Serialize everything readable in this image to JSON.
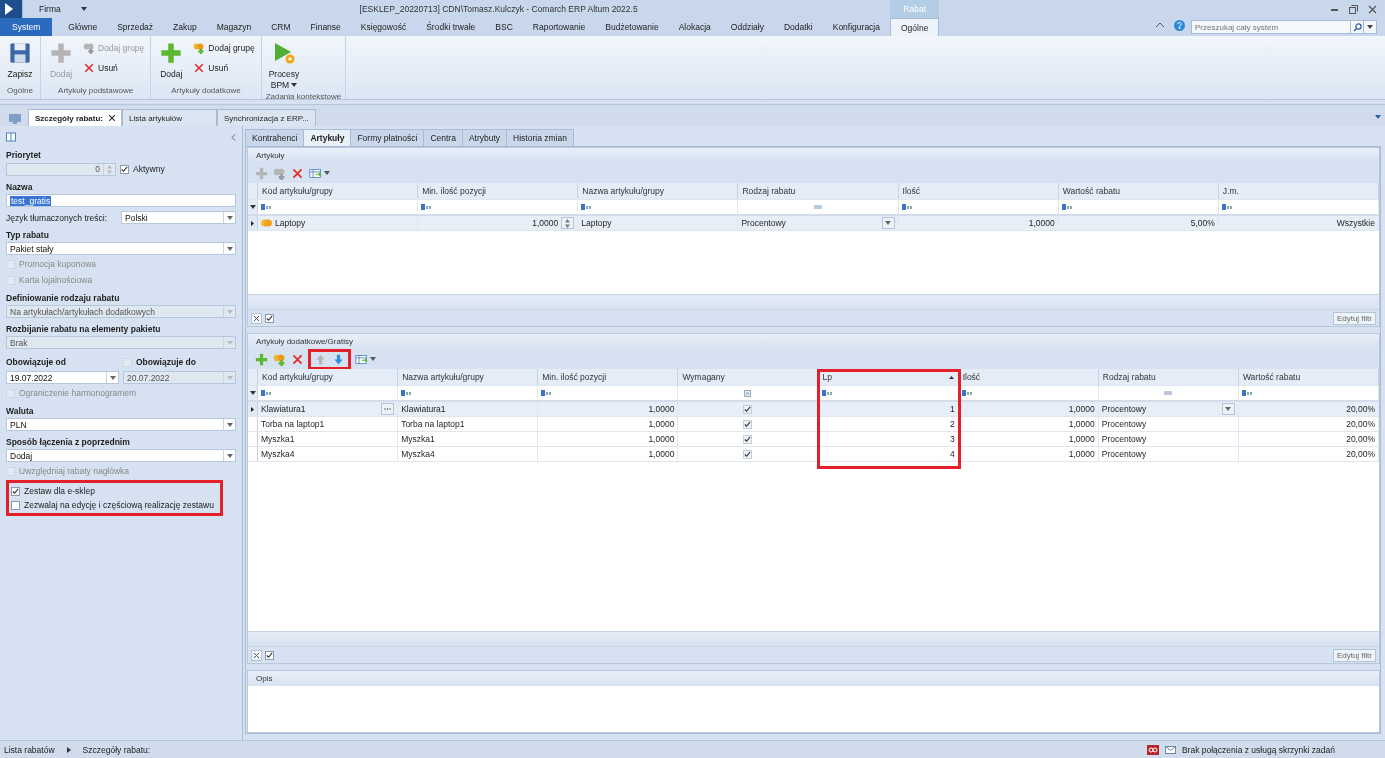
{
  "title_bar": {
    "company": "Firma",
    "title": "[ESKLEP_20220713] CDN\\Tomasz.Kulczyk - Comarch ERP Altum 2022.5"
  },
  "ribbon": {
    "context_label": "Rabat",
    "search_placeholder": "Przeszukaj cały system",
    "tabs": [
      {
        "label": "System",
        "kind": "file",
        "selected": false
      },
      {
        "label": "Główne",
        "kind": "tab",
        "selected": false
      },
      {
        "label": "Sprzedaż",
        "kind": "tab",
        "selected": false
      },
      {
        "label": "Zakup",
        "kind": "tab",
        "selected": false
      },
      {
        "label": "Magazyn",
        "kind": "tab",
        "selected": false
      },
      {
        "label": "CRM",
        "kind": "tab",
        "selected": false
      },
      {
        "label": "Finanse",
        "kind": "tab",
        "selected": false
      },
      {
        "label": "Księgowość",
        "kind": "tab",
        "selected": false
      },
      {
        "label": "Środki trwałe",
        "kind": "tab",
        "selected": false
      },
      {
        "label": "BSC",
        "kind": "tab",
        "selected": false
      },
      {
        "label": "Raportowanie",
        "kind": "tab",
        "selected": false
      },
      {
        "label": "Budżetowanie",
        "kind": "tab",
        "selected": false
      },
      {
        "label": "Alokacja",
        "kind": "tab",
        "selected": false
      },
      {
        "label": "Oddziały",
        "kind": "tab",
        "selected": false
      },
      {
        "label": "Dodatki",
        "kind": "tab",
        "selected": false
      },
      {
        "label": "Konfiguracja",
        "kind": "tab",
        "selected": false
      },
      {
        "label": "Ogólne",
        "kind": "contextual",
        "selected": true
      }
    ],
    "groups": [
      {
        "label": "Ogólne",
        "buttons": [
          {
            "kind": "save",
            "label": "Zapisz",
            "disabled": false
          }
        ]
      },
      {
        "label": "Artykuły podstawowe",
        "buttons": [
          {
            "kind": "add",
            "label": "Dodaj",
            "disabled": true
          },
          {
            "kind": "add_group",
            "label": "Dodaj grupę",
            "disabled": true
          },
          {
            "kind": "delete",
            "label": "Usuń",
            "disabled": false
          }
        ]
      },
      {
        "label": "Artykuły dodatkowe",
        "buttons": [
          {
            "kind": "add",
            "label": "Dodaj",
            "disabled": false
          },
          {
            "kind": "add_group",
            "label": "Dodaj grupę",
            "disabled": false
          },
          {
            "kind": "delete",
            "label": "Usuń",
            "disabled": false
          }
        ]
      },
      {
        "label": "Zadania kontekstowe",
        "buttons": [
          {
            "kind": "process",
            "label": "Procesy",
            "label2": "BPM",
            "dropdown": true,
            "disabled": false
          }
        ]
      }
    ]
  },
  "document_tabs": [
    {
      "label": "Szczegóły rabatu:",
      "selected": true,
      "closable": true
    },
    {
      "label": "Lista artykułów",
      "selected": false,
      "closable": false
    },
    {
      "label": "Synchronizacja z ERP...",
      "selected": false,
      "closable": false
    }
  ],
  "form": [
    {
      "kind": "spin",
      "label": "Priorytet",
      "value": "0",
      "checkbox": {
        "label": "Aktywny",
        "checked": true
      }
    },
    {
      "kind": "text",
      "label": "Nazwa",
      "value": "test_gratis",
      "value_selected": true
    },
    {
      "kind": "inline_combo",
      "label": "Język tłumaczonych treści:",
      "value": "Polski"
    },
    {
      "kind": "combo",
      "label": "Typ rabatu",
      "value": "Pakiet stały",
      "disabled": false
    },
    {
      "kind": "checkbox",
      "label": "Promocja kuponowa",
      "checked": false,
      "disabled": true
    },
    {
      "kind": "checkbox",
      "label": "Karta lojalnościowa",
      "checked": false,
      "disabled": true
    },
    {
      "kind": "combo",
      "label": "Definiowanie rodzaju rabatu",
      "value": "Na artykułach/artykułach dodatkowych",
      "disabled": true
    },
    {
      "kind": "combo",
      "label": "Rozbijanie rabatu na elementy pakietu",
      "value": "Brak",
      "disabled": true
    },
    {
      "kind": "date_pair",
      "from": {
        "label": "Obowiązuje od",
        "value": "19.07.2022",
        "disabled": false
      },
      "to": {
        "label": "Obowiązuje do",
        "value": "20.07.2022",
        "checked": false,
        "disabled": true
      }
    },
    {
      "kind": "checkbox",
      "label": "Ograniczenie harmonogramem",
      "checked": false,
      "disabled": true
    },
    {
      "kind": "combo",
      "label": "Waluta",
      "value": "PLN",
      "disabled": false
    },
    {
      "kind": "combo",
      "label": "Sposób łączenia z poprzednim",
      "value": "Dodaj",
      "disabled": false
    },
    {
      "kind": "checkbox",
      "label": "Uwzględniaj rabaty nagłówka",
      "checked": false,
      "disabled": true
    },
    {
      "kind": "checkbox_group",
      "highlighted": true,
      "items": [
        {
          "label": "Zestaw dla e-sklep",
          "checked": true,
          "disabled": false
        },
        {
          "label": "Zezwalaj na edycję i częściową realizację zestawu",
          "checked": false,
          "disabled": false
        }
      ]
    }
  ],
  "inner_tabs": [
    {
      "label": "Kontrahenci",
      "selected": false
    },
    {
      "label": "Artykuły",
      "selected": true
    },
    {
      "label": "Formy płatności",
      "selected": false
    },
    {
      "label": "Centra",
      "selected": false
    },
    {
      "label": "Atrybuty",
      "selected": false
    },
    {
      "label": "Historia zmian",
      "selected": false
    }
  ],
  "grids": [
    {
      "title": "Artykuły",
      "footer_button": "Edytuj filtr",
      "filter_enabled": true,
      "toolbar": [
        {
          "kind": "add",
          "disabled": true,
          "highlighted": false
        },
        {
          "kind": "add_group",
          "disabled": true,
          "highlighted": false
        },
        {
          "kind": "delete",
          "disabled": false,
          "highlighted": false
        },
        {
          "kind": "export",
          "disabled": false,
          "highlighted": false
        }
      ],
      "columns": [
        {
          "label": "Kod artykułu/grupy",
          "kind": "text",
          "highlighted": false,
          "sorted": false
        },
        {
          "label": "Min. ilość pozycji",
          "kind": "spin",
          "highlighted": false,
          "sorted": false
        },
        {
          "label": "Nazwa artykułu/grupy",
          "kind": "text",
          "highlighted": false,
          "sorted": false
        },
        {
          "label": "Rodzaj rabatu",
          "kind": "combo",
          "highlighted": false,
          "sorted": false
        },
        {
          "label": "Ilość",
          "kind": "number",
          "highlighted": false,
          "sorted": false
        },
        {
          "label": "Wartość rabatu",
          "kind": "number",
          "highlighted": false,
          "sorted": false
        },
        {
          "label": "J.m.",
          "kind": "number",
          "highlighted": false,
          "sorted": false
        }
      ],
      "rows": [
        {
          "kind": "group",
          "selected": true,
          "cells": [
            "Laptopy",
            "1,0000",
            "Laptopy",
            "Procentowy",
            "1,0000",
            "5,00%",
            "Wszystkie"
          ]
        }
      ]
    },
    {
      "title": "Artykuły dodatkowe/Gratisy",
      "footer_button": "Edytuj filtr",
      "filter_enabled": true,
      "toolbar": [
        {
          "kind": "add",
          "disabled": false,
          "highlighted": false
        },
        {
          "kind": "add_group",
          "disabled": false,
          "highlighted": false
        },
        {
          "kind": "delete",
          "disabled": false,
          "highlighted": false
        },
        {
          "kind": "up",
          "disabled": true,
          "highlighted": true
        },
        {
          "kind": "down",
          "disabled": false,
          "highlighted": true
        },
        {
          "kind": "export",
          "disabled": false,
          "highlighted": false
        }
      ],
      "columns": [
        {
          "label": "Kod artykułu/grupy",
          "kind": "lookup",
          "highlighted": false,
          "sorted": false
        },
        {
          "label": "Nazwa artykułu/grupy",
          "kind": "text",
          "highlighted": false,
          "sorted": false
        },
        {
          "label": "Min. ilość pozycji",
          "kind": "number",
          "highlighted": false,
          "sorted": false
        },
        {
          "label": "Wymagany",
          "kind": "check",
          "highlighted": false,
          "sorted": false
        },
        {
          "label": "Lp",
          "kind": "number",
          "highlighted": true,
          "sorted": true
        },
        {
          "label": "Ilość",
          "kind": "number",
          "highlighted": false,
          "sorted": false
        },
        {
          "label": "Rodzaj rabatu",
          "kind": "combo",
          "highlighted": false,
          "sorted": false
        },
        {
          "label": "Wartość rabatu",
          "kind": "number",
          "highlighted": false,
          "sorted": false
        }
      ],
      "rows": [
        {
          "kind": "item",
          "selected": true,
          "cells": [
            "Klawiatura1",
            "Klawiatura1",
            "1,0000",
            true,
            "1",
            "1,0000",
            "Procentowy",
            "20,00%"
          ]
        },
        {
          "kind": "item",
          "selected": false,
          "cells": [
            "Torba na laptop1",
            "Torba na laptop1",
            "1,0000",
            true,
            "2",
            "1,0000",
            "Procentowy",
            "20,00%"
          ]
        },
        {
          "kind": "item",
          "selected": false,
          "cells": [
            "Myszka1",
            "Myszka1",
            "1,0000",
            true,
            "3",
            "1,0000",
            "Procentowy",
            "20,00%"
          ]
        },
        {
          "kind": "item",
          "selected": false,
          "cells": [
            "Myszka4",
            "Myszka4",
            "1,0000",
            true,
            "4",
            "1,0000",
            "Procentowy",
            "20,00%"
          ]
        }
      ]
    }
  ],
  "description_panel": {
    "title": "Opis"
  },
  "status_bar": {
    "breadcrumbs": [
      "Lista rabatów",
      "Szczegóły rabatu:"
    ],
    "message": "Brak połączenia z usługą skrzynki zadań"
  }
}
